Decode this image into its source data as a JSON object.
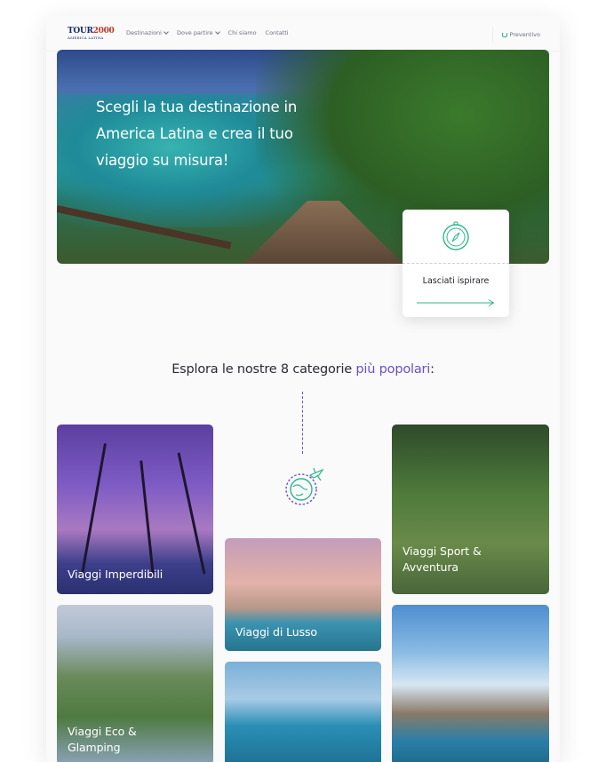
{
  "brand": {
    "logo_top": "TOUR",
    "logo_num": "2000",
    "logo_bottom": "AMERICA LATINA"
  },
  "nav": {
    "items": [
      {
        "label": "Destinazioni"
      },
      {
        "label": "Dove partire"
      },
      {
        "label": "Chi siamo"
      },
      {
        "label": "Contatti"
      }
    ],
    "quote_label": "Preventivo"
  },
  "hero": {
    "title": "Scegli la tua destinazione in America Latina e crea il tuo viaggio su misura!"
  },
  "inspire": {
    "label": "Lasciati ispirare"
  },
  "categories_heading": {
    "before": "Esplora le nostre 8 categorie ",
    "highlight": "più popolari",
    "after": ":"
  },
  "categories": [
    {
      "title": "Viaggi Imperdibili"
    },
    {
      "title": "Viaggi Sport & Avventura"
    },
    {
      "title": "Viaggi di Lusso"
    },
    {
      "title": "Viaggi Eco & Glamping"
    }
  ],
  "colors": {
    "accent_green": "#2fb68a",
    "accent_purple": "#6a4fd0",
    "text_dark": "#2a2b36"
  }
}
